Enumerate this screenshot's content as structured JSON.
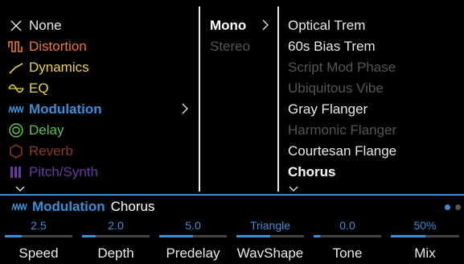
{
  "categories": [
    {
      "label": "None",
      "color": "#e8e8e8",
      "icon": "close-icon"
    },
    {
      "label": "Distortion",
      "color": "#e87a2e",
      "icon": "distortion-icon"
    },
    {
      "label": "Dynamics",
      "color": "#e8d34a",
      "icon": "dynamics-icon"
    },
    {
      "label": "EQ",
      "color": "#e8d34a",
      "icon": "eq-icon"
    },
    {
      "label": "Modulation",
      "color": "#3a8fd6",
      "icon": "modulation-icon",
      "selected": true
    },
    {
      "label": "Delay",
      "color": "#5cc24a",
      "icon": "delay-icon"
    },
    {
      "label": "Reverb",
      "color": "#8a3a22",
      "icon": "reverb-icon"
    },
    {
      "label": "Pitch/Synth",
      "color": "#6a3aa0",
      "icon": "pitch-synth-icon"
    }
  ],
  "modes": [
    {
      "label": "Mono",
      "selected": true
    },
    {
      "label": "Stereo",
      "selected": false
    }
  ],
  "models": [
    {
      "label": "Optical Trem",
      "state": "available"
    },
    {
      "label": "60s Bias Trem",
      "state": "available"
    },
    {
      "label": "Script Mod Phase",
      "state": "dimmed"
    },
    {
      "label": "Ubiquitous Vibe",
      "state": "dimmed"
    },
    {
      "label": "Gray Flanger",
      "state": "available"
    },
    {
      "label": "Harmonic Flanger",
      "state": "dimmed"
    },
    {
      "label": "Courtesan Flange",
      "state": "available"
    },
    {
      "label": "Chorus",
      "state": "selected"
    }
  ],
  "status": {
    "category": "Modulation",
    "model": "Chorus",
    "page_count": 2,
    "current_page": 1
  },
  "params": [
    {
      "name": "Speed",
      "value": "2.5",
      "level": 0.25
    },
    {
      "name": "Depth",
      "value": "2.0",
      "level": 0.2
    },
    {
      "name": "Predelay",
      "value": "5.0",
      "level": 0.5
    },
    {
      "name": "WavShape",
      "value": "Triangle",
      "level": 0.5
    },
    {
      "name": "Tone",
      "value": "0.0",
      "level": 0.1
    },
    {
      "name": "Mix",
      "value": "50%",
      "level": 0.5
    }
  ],
  "colors": {
    "accent": "#3a8fd6",
    "text": "#e8e8e8",
    "dimmed": "#555555",
    "track": "#444444"
  }
}
